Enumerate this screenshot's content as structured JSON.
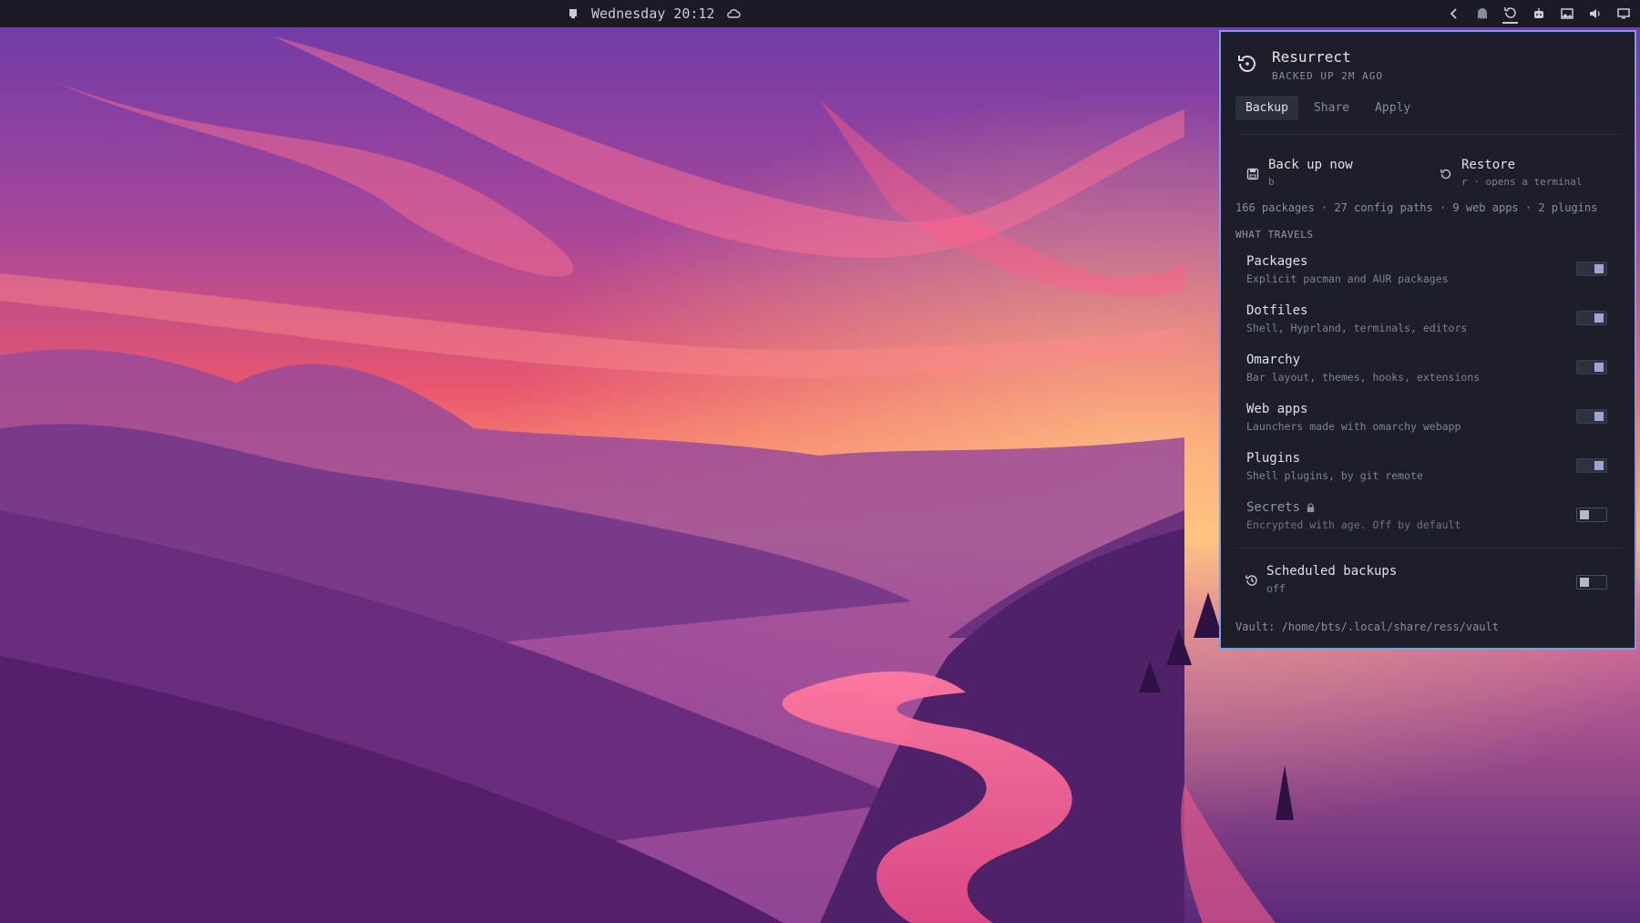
{
  "topbar": {
    "clock": "Wednesday 20:12",
    "left_icon": "window-icon",
    "weather_icon": "cloud-icon",
    "tray_icons": [
      "chevron-left-icon",
      "ghost-icon",
      "resurrect-icon",
      "bot-icon",
      "screenshot-icon",
      "volume-icon",
      "display-icon"
    ]
  },
  "panel": {
    "title": "Resurrect",
    "subtitle": "BACKED UP 2M AGO",
    "tabs": [
      {
        "label": "Backup",
        "active": true
      },
      {
        "label": "Share",
        "active": false
      },
      {
        "label": "Apply",
        "active": false
      }
    ],
    "actions": [
      {
        "label": "Back up now",
        "hint": "b",
        "icon": "save-icon"
      },
      {
        "label": "Restore",
        "hint": "r · opens a terminal",
        "icon": "restore-icon"
      }
    ],
    "stats": "166 packages · 27 config paths · 9 web apps · 2 plugins",
    "section_title": "WHAT TRAVELS",
    "items": [
      {
        "label": "Packages",
        "desc": "Explicit pacman and AUR packages",
        "on": true
      },
      {
        "label": "Dotfiles",
        "desc": "Shell, Hyprland, terminals, editors",
        "on": true
      },
      {
        "label": "Omarchy",
        "desc": "Bar layout, themes, hooks, extensions",
        "on": true
      },
      {
        "label": "Web apps",
        "desc": "Launchers made with omarchy webapp",
        "on": true
      },
      {
        "label": "Plugins",
        "desc": "Shell plugins, by git remote",
        "on": true
      },
      {
        "label": "Secrets",
        "desc": "Encrypted with age. Off by default",
        "on": false,
        "icon": "lock-icon"
      }
    ],
    "scheduled": {
      "label": "Scheduled backups",
      "desc": "off",
      "on": false,
      "icon": "history-icon"
    },
    "vault": "Vault: /home/bts/.local/share/ress/vault"
  },
  "colors": {
    "accent_border": "#7d9fe0",
    "panel_bg": "#1d1e29",
    "bar_bg": "#1a1b26"
  }
}
